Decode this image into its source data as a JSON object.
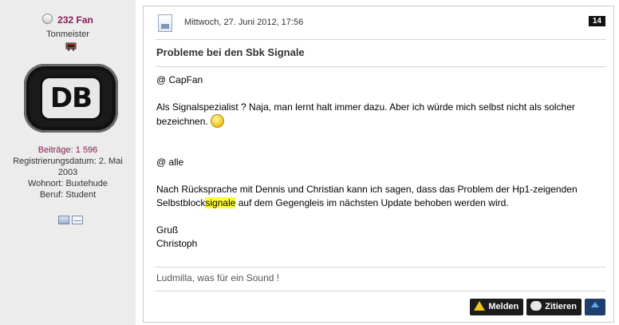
{
  "author": {
    "username": "232 Fan",
    "rank": "Tonmeister",
    "avatar_text": "DB",
    "posts": "Beiträge: 1 596",
    "registered_line1": "Registrierungsdatum: 2. Mai",
    "registered_line2": "2003",
    "location": "Wohnort: Buxtehude",
    "job": "Beruf: Student"
  },
  "post": {
    "date": "Mittwoch, 27. Juni 2012, 17:56",
    "number": "14",
    "title": "Probleme bei den Sbk Signale",
    "greeting1": "@ CapFan",
    "para1": "Als Signalspezialist ? Naja, man lernt halt immer dazu. Aber ich würde mich selbst nicht als solcher bezeichnen.",
    "greeting2": "@ alle",
    "para2_before": "Nach Rücksprache mit Dennis und Christian kann ich sagen, dass das Problem der Hp1-zeigenden Selbstblock",
    "para2_highlight": "signale",
    "para2_after": " auf dem Gegengleis im nächsten Update behoben werden wird.",
    "closing": "Gruß",
    "name": "Christoph",
    "signature": "Ludmilla, was für ein Sound !"
  },
  "buttons": {
    "report": "Melden",
    "quote": "Zitieren"
  },
  "icons": {
    "status": "status-offline-icon",
    "rank": "rank-icon",
    "profile": "profile-card-icon",
    "mail": "mail-icon",
    "post": "document-icon",
    "smiley": "smiley-icon",
    "report": "warning-icon",
    "quote": "speech-bubble-icon",
    "top": "arrow-up-icon"
  },
  "colors": {
    "username": "#8a1c56",
    "highlight": "#ffff33",
    "button_bg": "#1b1b1b"
  }
}
